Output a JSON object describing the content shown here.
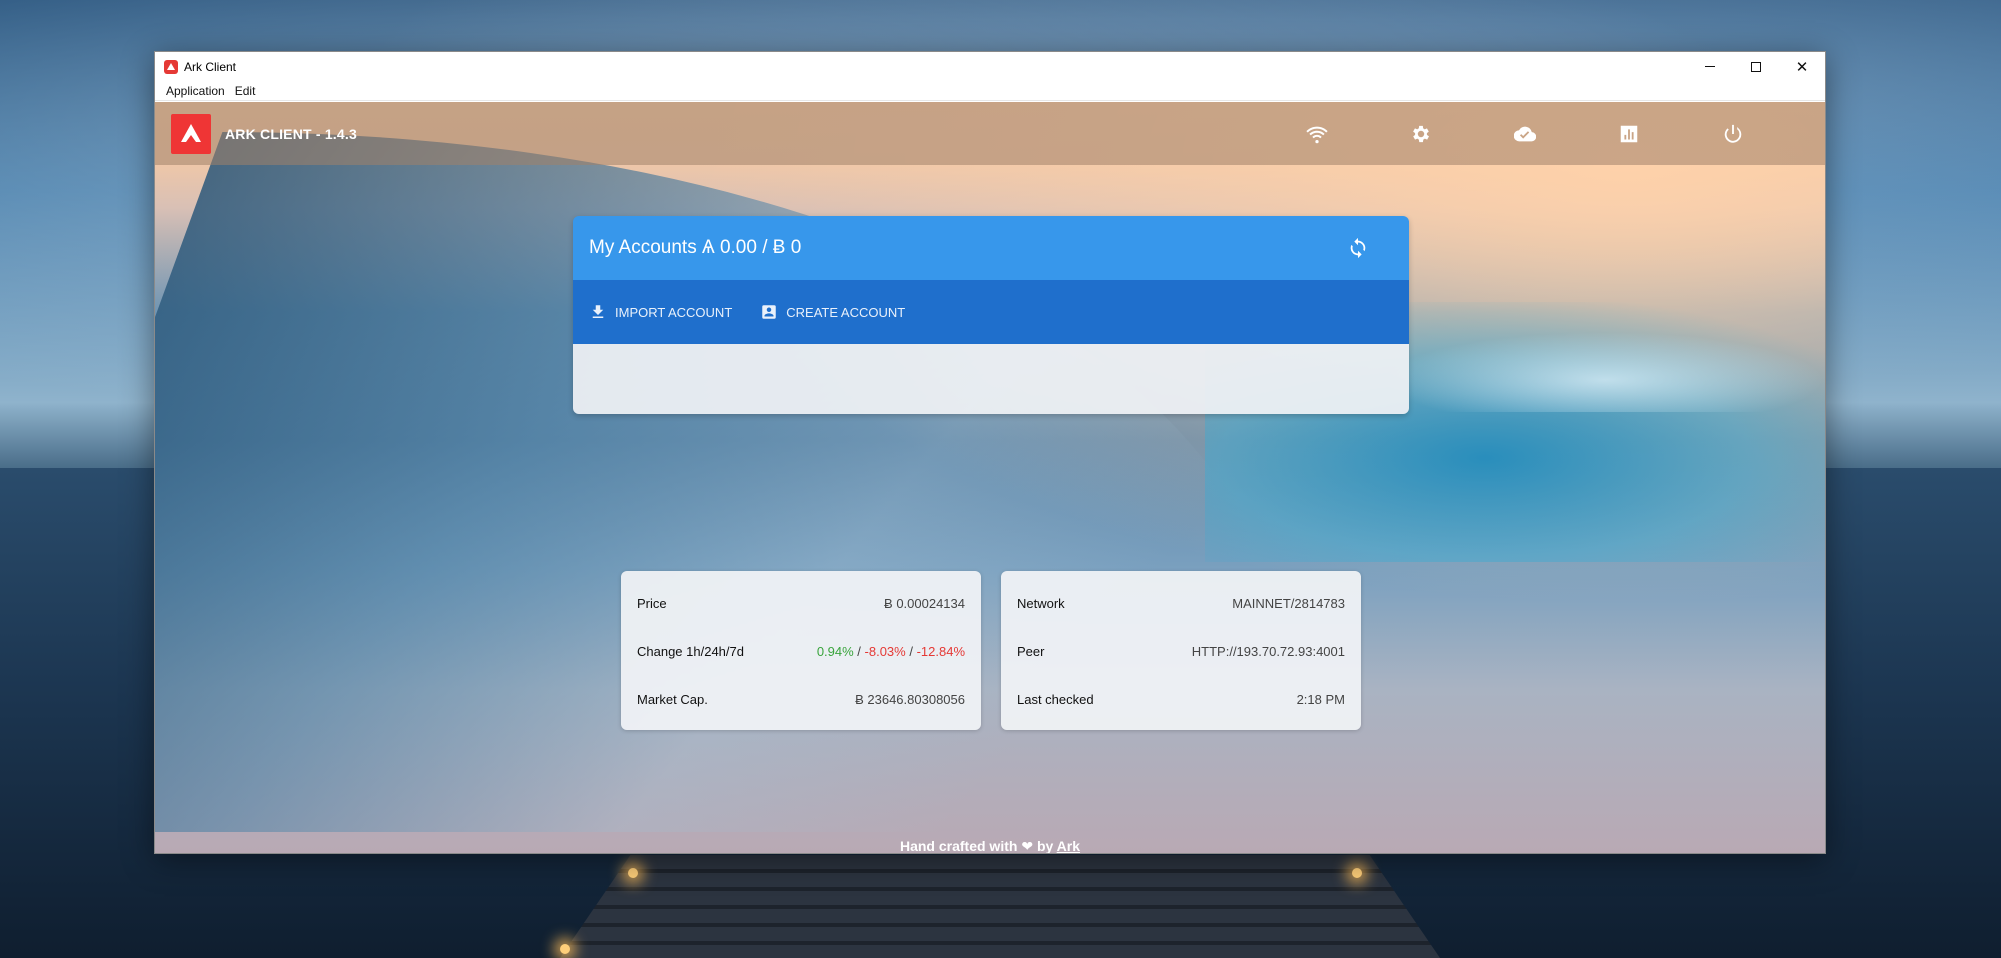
{
  "window": {
    "title": "Ark Client",
    "menu": [
      "Application",
      "Edit"
    ]
  },
  "header": {
    "brand": "ARK CLIENT - 1.4.3",
    "icons": [
      "wifi-icon",
      "gear-icon",
      "cloud-done-icon",
      "chart-icon",
      "power-icon"
    ]
  },
  "accounts": {
    "title": "My Accounts Ѧ 0.00 / Ƀ 0",
    "import_label": "IMPORT ACCOUNT",
    "create_label": "CREATE ACCOUNT"
  },
  "market": {
    "price_label": "Price",
    "price_value": "Ƀ 0.00024134",
    "change_label": "Change 1h/24h/7d",
    "change_1h": "0.94%",
    "change_24h": "-8.03%",
    "change_7d": "-12.84%",
    "change_sep": " / ",
    "cap_label": "Market Cap.",
    "cap_value": "Ƀ 23646.80308056"
  },
  "network": {
    "network_label": "Network",
    "network_value": "MAINNET/2814783",
    "peer_label": "Peer",
    "peer_value": "HTTP://193.70.72.93:4001",
    "checked_label": "Last checked",
    "checked_value": "2:18 PM"
  },
  "footer": {
    "prefix": "Hand crafted with",
    "heart": "❤",
    "by": "by",
    "link": "Ark"
  },
  "colors": {
    "accent": "#3797eb",
    "accent_dark": "#1f6fcc",
    "logo": "#ef3535",
    "positive": "#39a43c",
    "negative": "#e53935"
  }
}
